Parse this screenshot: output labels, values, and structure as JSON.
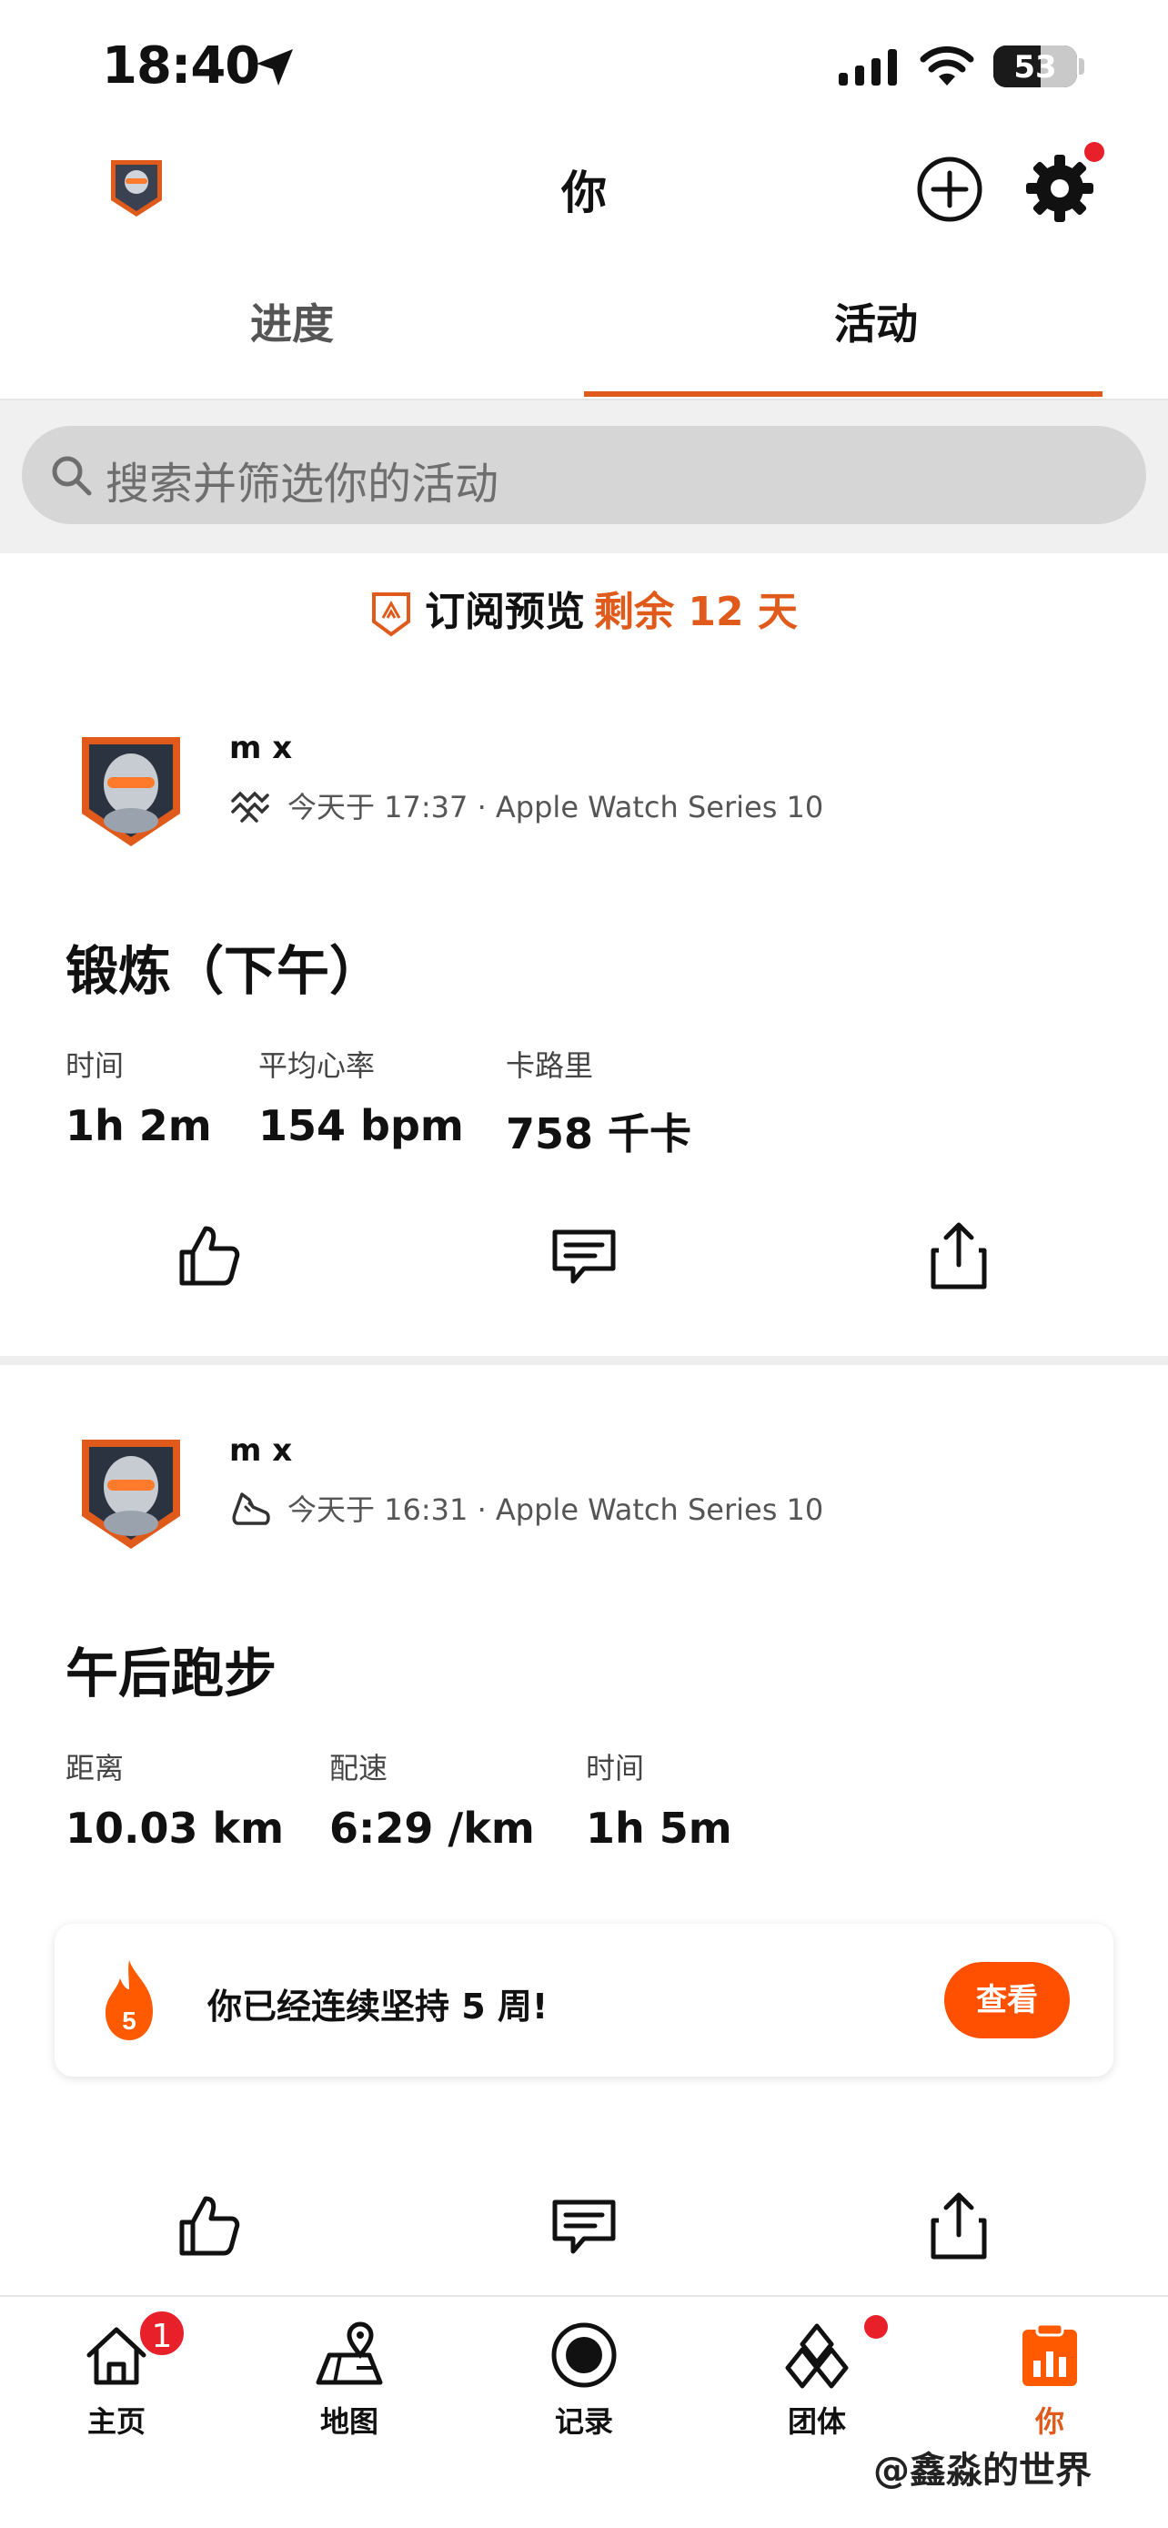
{
  "status_bar": {
    "time": "18:40",
    "battery": "53"
  },
  "header": {
    "title": "你"
  },
  "tabs": [
    {
      "label": "进度"
    },
    {
      "label": "活动"
    }
  ],
  "search": {
    "placeholder": "搜索并筛选你的活动"
  },
  "promo": {
    "label": "订阅预览",
    "highlight": "剩余 12 天"
  },
  "activities": [
    {
      "user": "m x",
      "meta": "今天于 17:37 · Apple Watch Series 10",
      "icon": "workout-icon",
      "title": "锻炼（下午）",
      "stats": [
        {
          "label": "时间",
          "value": "1h 2m"
        },
        {
          "label": "平均心率",
          "value": "154 bpm"
        },
        {
          "label": "卡路里",
          "value": "758 千卡"
        }
      ]
    },
    {
      "user": "m x",
      "meta": "今天于 16:31 · Apple Watch Series 10",
      "icon": "run-shoe-icon",
      "title": "午后跑步",
      "stats": [
        {
          "label": "距离",
          "value": "10.03 km"
        },
        {
          "label": "配速",
          "value": "6:29 /km"
        },
        {
          "label": "时间",
          "value": "1h 5m"
        }
      ]
    }
  ],
  "streak": {
    "weeks": "5",
    "text": "你已经连续坚持 5 周!",
    "button": "查看"
  },
  "bottom_nav": {
    "items": [
      {
        "label": "主页",
        "badge": "1"
      },
      {
        "label": "地图"
      },
      {
        "label": "记录"
      },
      {
        "label": "团体"
      },
      {
        "label": "你"
      }
    ]
  },
  "watermark": "@鑫淼的世界",
  "colors": {
    "accent": "#e05a1b",
    "button": "#ff4f00",
    "badge": "#e8202a"
  }
}
